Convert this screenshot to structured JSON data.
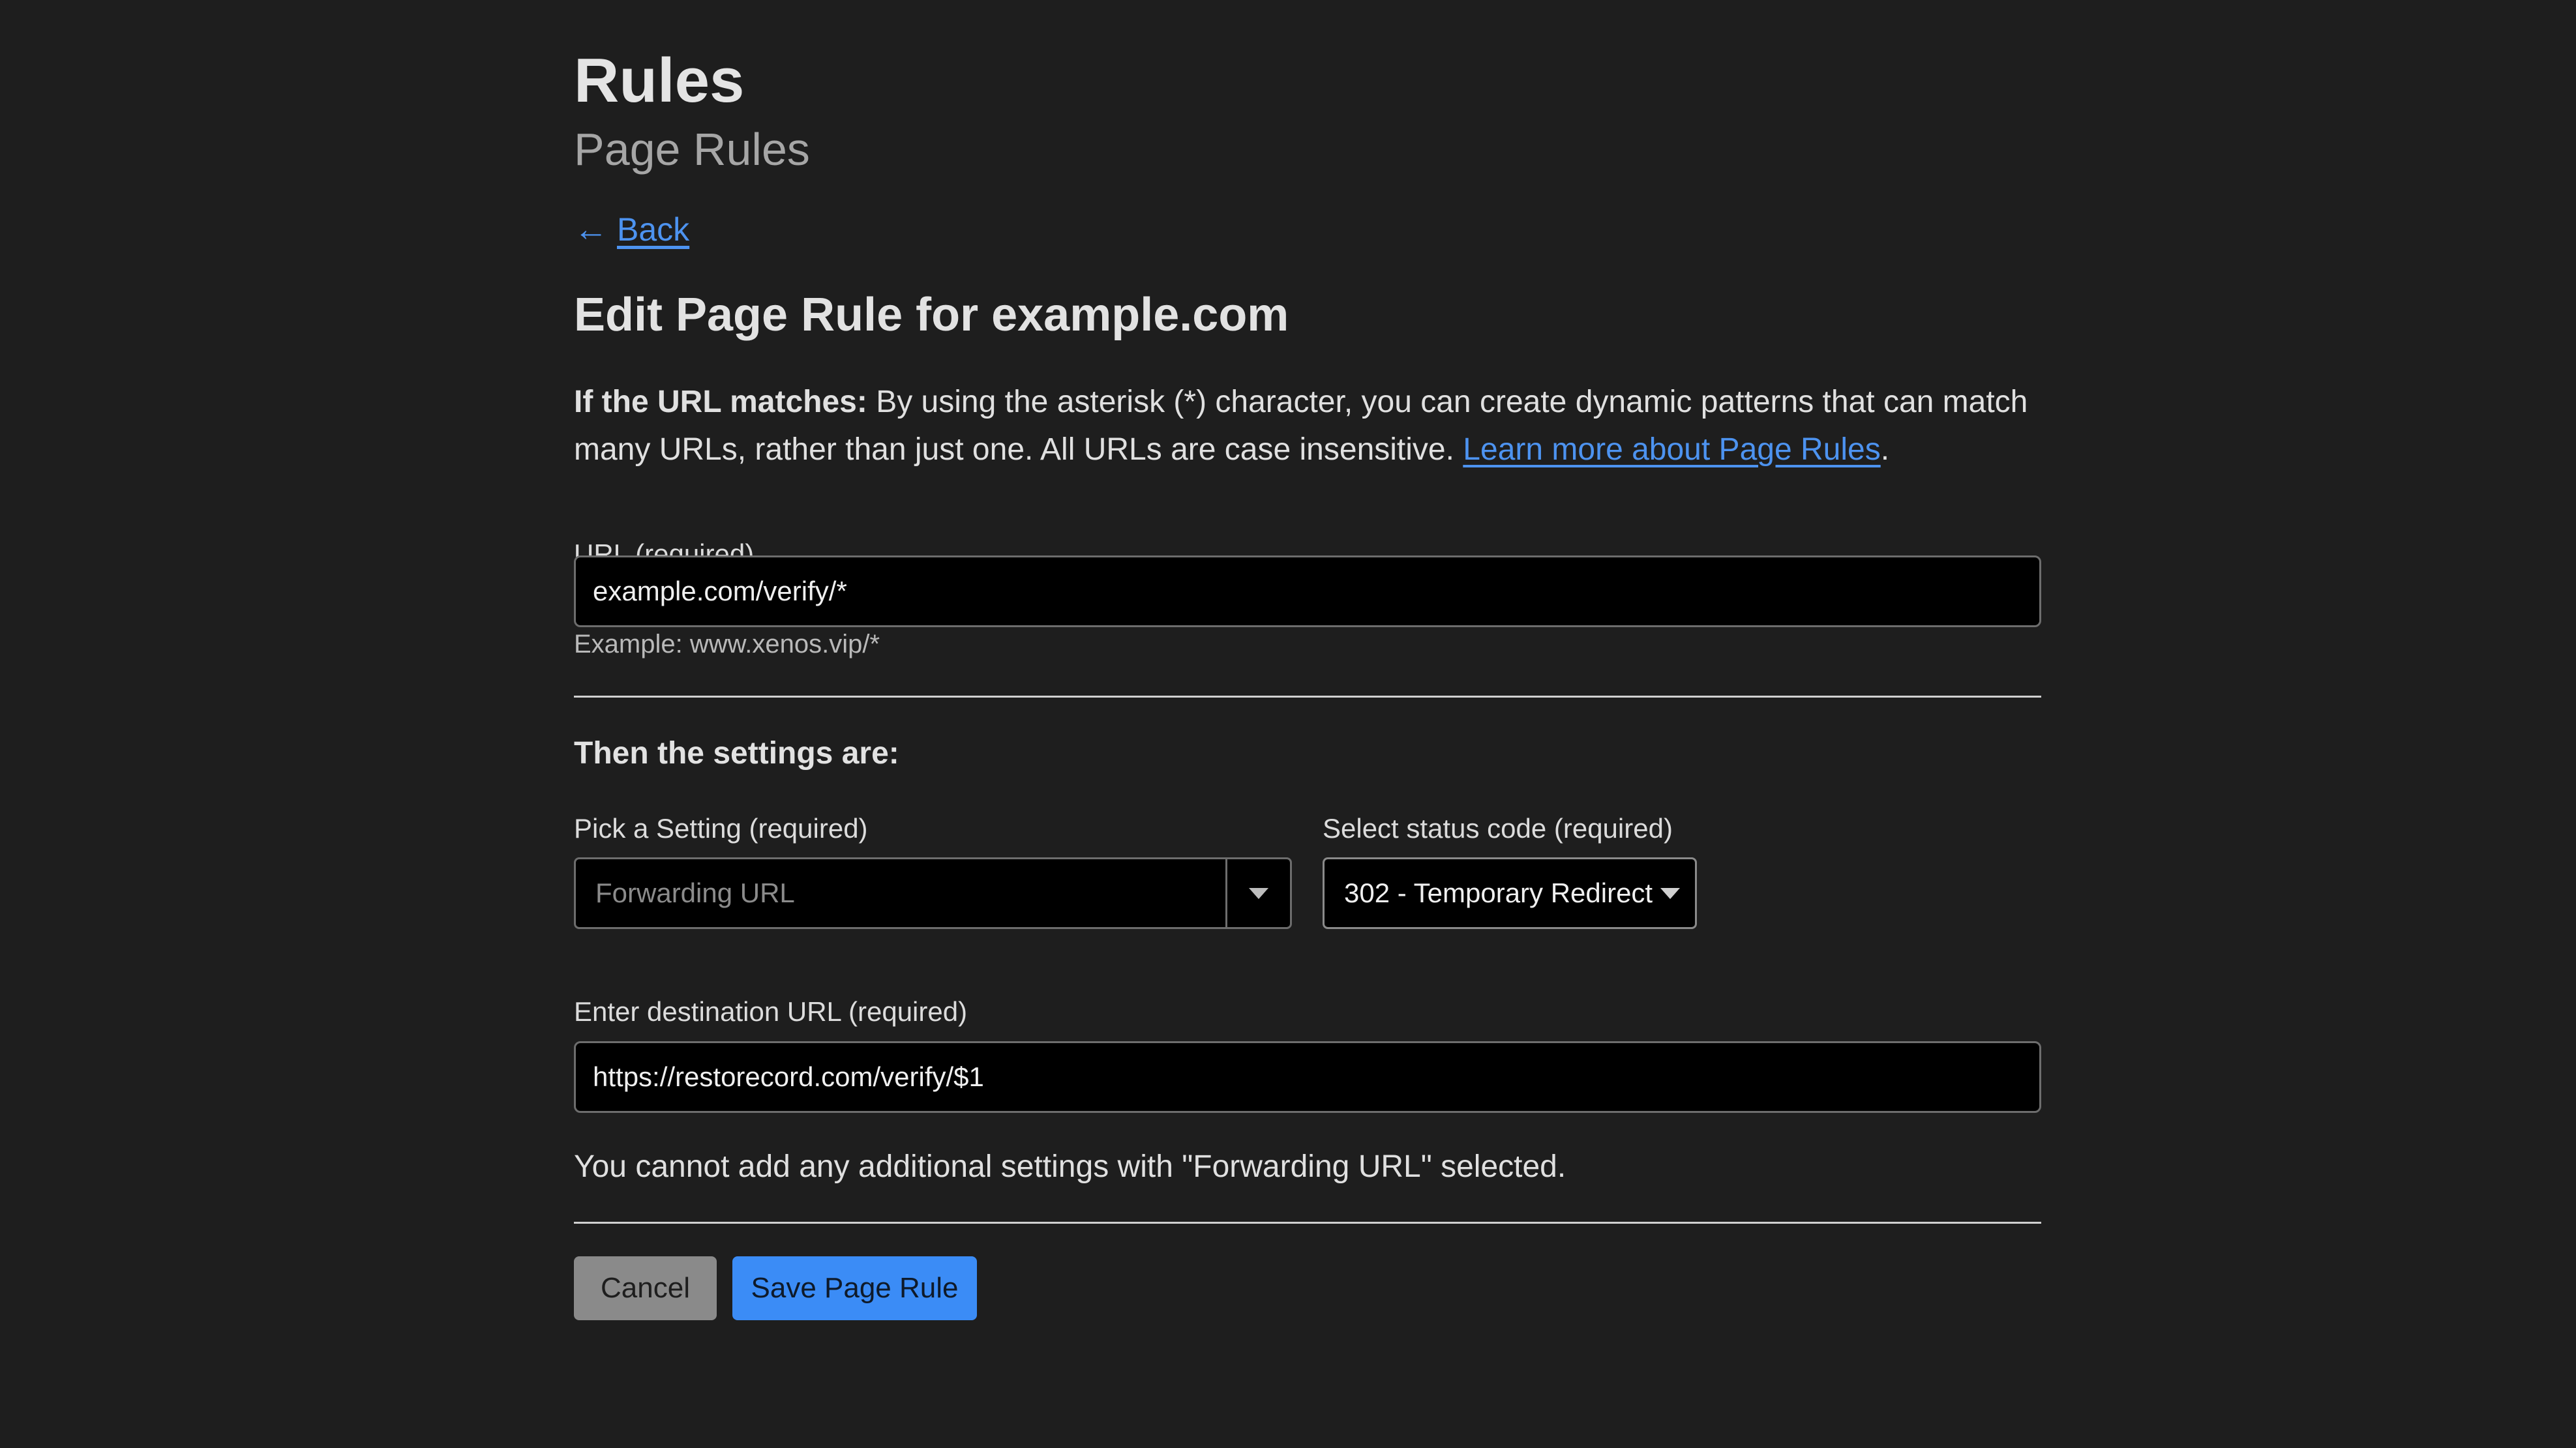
{
  "page": {
    "title": "Rules",
    "subtitle": "Page Rules",
    "back_label": "Back",
    "heading": "Edit Page Rule for example.com"
  },
  "description": {
    "bold": "If the URL matches:",
    "text": " By using the asterisk (*) character, you can create dynamic patterns that can match many URLs, rather than just one. All URLs are case insensitive. ",
    "link": "Learn more about Page Rules",
    "end": "."
  },
  "url_field": {
    "label": "URL (required)",
    "value": "example.com/verify/*",
    "hint": "Example: www.xenos.vip/*"
  },
  "settings": {
    "title": "Then the settings are:",
    "setting_label": "Pick a Setting (required)",
    "setting_value": "Forwarding URL",
    "status_label": "Select status code (required)",
    "status_value": "302 - Temporary Redirect",
    "destination_label": "Enter destination URL (required)",
    "destination_value": "https://restorecord.com/verify/$1",
    "note": "You cannot add any additional settings with \"Forwarding URL\" selected."
  },
  "actions": {
    "cancel_label": "Cancel",
    "save_label": "Save Page Rule"
  },
  "colors": {
    "background": "#1e1e1e",
    "link": "#4d93f0",
    "primary_button": "#3b8cf6",
    "secondary_button": "#8a8a8a"
  },
  "icons": {
    "back": "arrow-left-icon",
    "dropdown": "caret-down-icon"
  }
}
